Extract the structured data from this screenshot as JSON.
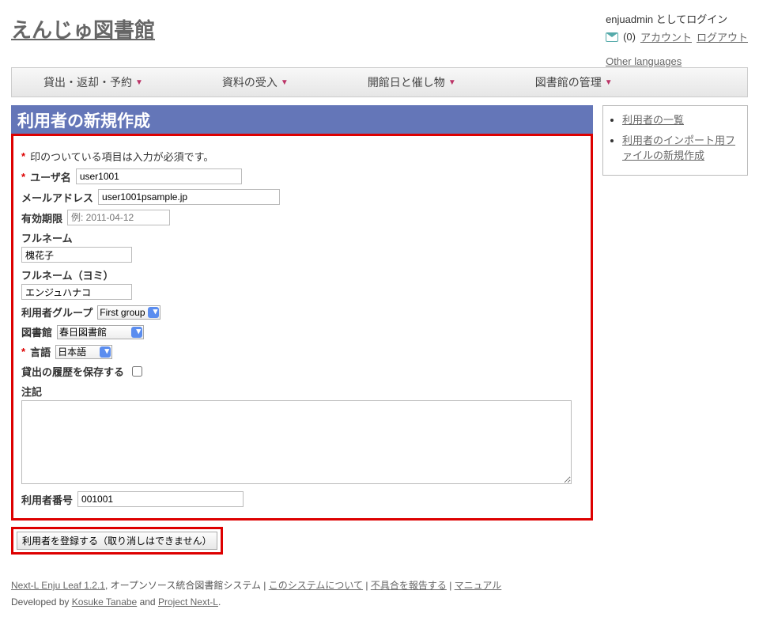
{
  "site_title": "えんじゅ図書館",
  "login": {
    "status": "enjuadmin としてログイン",
    "mail_count": "(0)",
    "account": "アカウント",
    "logout": "ログアウト",
    "other_languages": "Other languages"
  },
  "menu": {
    "checkout": "貸出・返却・予約",
    "acquisition": "資料の受入",
    "calendar": "開館日と催し物",
    "admin": "図書館の管理"
  },
  "page_title": "利用者の新規作成",
  "form": {
    "required_note": "印のついている項目は入力が必須です。",
    "username_label": "ユーザ名",
    "username_value": "user1001",
    "email_label": "メールアドレス",
    "email_value": "user1001psample.jp",
    "expire_label": "有効期限",
    "expire_placeholder": "例: 2011-04-12",
    "fullname_label": "フルネーム",
    "fullname_value": "槐花子",
    "fullname_kana_label": "フルネーム（ヨミ）",
    "fullname_kana_value": "エンジュハナコ",
    "group_label": "利用者グループ",
    "group_selected": "First group",
    "library_label": "図書館",
    "library_selected": "春日図書館",
    "locale_label": "言語",
    "locale_selected": "日本語",
    "save_history_label": "貸出の履歴を保存する",
    "note_label": "注記",
    "user_number_label": "利用者番号",
    "user_number_value": "001001",
    "submit_label": "利用者を登録する（取り消しはできません）"
  },
  "sidebar": {
    "link1": "利用者の一覧",
    "link2": "利用者のインポート用ファイルの新規作成"
  },
  "footer": {
    "product": "Next-L Enju Leaf 1.2.1",
    "product_tail": ", オープンソース統合図書館システム |",
    "about": "このシステムについて",
    "sep1": " | ",
    "report": "不具合を報告する",
    "sep2": " | ",
    "manual": "マニュアル",
    "dev_lead": "Developed by ",
    "dev1": "Kosuke Tanabe",
    "dev_mid": " and ",
    "dev2": "Project Next-L",
    "dev_tail": "."
  }
}
